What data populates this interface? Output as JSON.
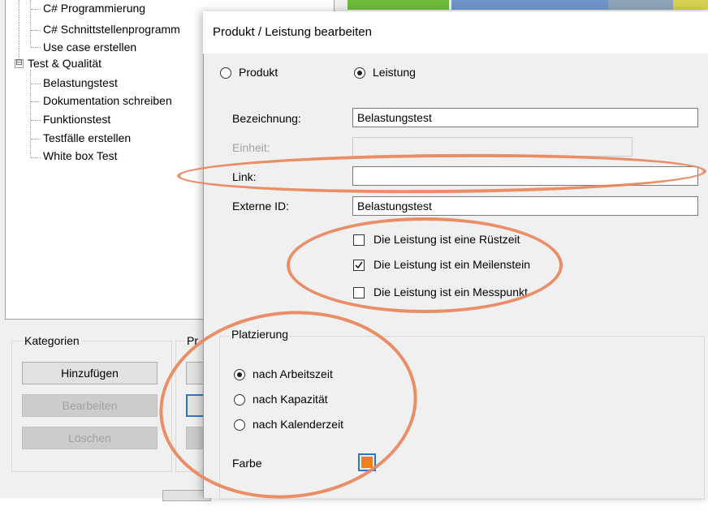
{
  "tree": {
    "items": [
      {
        "label": "C# Programmierung",
        "level": 2
      },
      {
        "label": "C# Schnittstellenprogramm",
        "level": 2
      },
      {
        "label": "Use case erstellen",
        "level": 2
      },
      {
        "label": "Test & Qualität",
        "level": 1,
        "expander": "⊟"
      },
      {
        "label": "Belastungstest",
        "level": 2
      },
      {
        "label": "Dokumentation schreiben",
        "level": 2
      },
      {
        "label": "Funktionstest",
        "level": 2
      },
      {
        "label": "Testfälle erstellen",
        "level": 2
      },
      {
        "label": "White box Test",
        "level": 2
      }
    ]
  },
  "kategorien": {
    "title": "Kategorien",
    "add": "Hinzufügen",
    "edit": "Bearbeiten",
    "delete": "Löschen"
  },
  "second_group": {
    "title_fragment": "Pr"
  },
  "dialog": {
    "title": "Produkt / Leistung bearbeiten",
    "type_options": [
      {
        "label": "Produkt",
        "selected": false
      },
      {
        "label": "Leistung",
        "selected": true
      }
    ],
    "fields": {
      "bezeichnung_label": "Bezeichnung:",
      "bezeichnung_value": "Belastungstest",
      "einheit_label": "Einheit:",
      "einheit_value": "",
      "link_label": "Link:",
      "link_value": "",
      "externe_id_label": "Externe ID:",
      "externe_id_value": "Belastungstest"
    },
    "checkboxes": [
      {
        "label": "Die Leistung ist eine Rüstzeit",
        "checked": false
      },
      {
        "label": "Die Leistung ist ein Meilenstein",
        "checked": true
      },
      {
        "label": "Die Leistung ist ein Messpunkt",
        "checked": false
      }
    ],
    "platzierung": {
      "title": "Platzierung",
      "options": [
        {
          "label": "nach Arbeitszeit",
          "selected": true
        },
        {
          "label": "nach Kapazität",
          "selected": false
        },
        {
          "label": "nach Kalenderzeit",
          "selected": false
        }
      ]
    },
    "farbe_label": "Farbe",
    "farbe_color": "#f07e1a",
    "annotation_color": "#e8865a"
  }
}
